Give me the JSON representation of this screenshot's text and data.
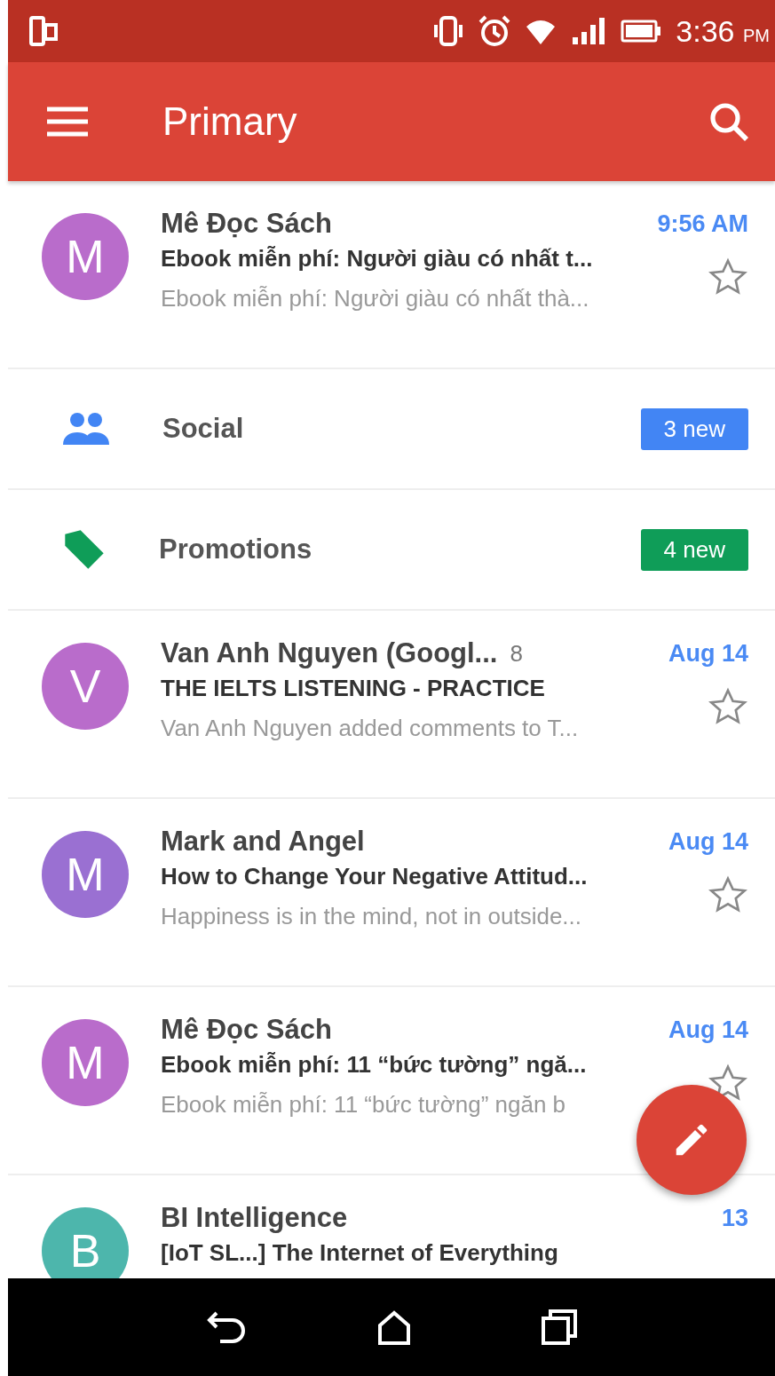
{
  "status_bar": {
    "time": "3:36",
    "ampm": "PM"
  },
  "app_bar": {
    "title": "Primary"
  },
  "items": [
    {
      "kind": "mail",
      "letter": "M",
      "color": "#b96ccb",
      "sender": "Mê Đọc Sách",
      "date": "9:56 AM",
      "subject": "Ebook miễn phí: Người giàu có nhất t...",
      "snippet": "Ebook miễn phí: Người giàu có nhất thà...",
      "starred": false
    },
    {
      "kind": "social",
      "color": "#4285f4",
      "label": "Social",
      "badge": "3 new"
    },
    {
      "kind": "promotions",
      "color": "#0f9d58",
      "label": "Promotions",
      "badge": "4 new"
    },
    {
      "kind": "mail",
      "letter": "V",
      "color": "#b96ccb",
      "sender": "Van Anh Nguyen (Googl...",
      "count": "8",
      "date": "Aug 14",
      "subject": "THE IELTS LISTENING - PRACTICE",
      "snippet": "Van Anh Nguyen added comments to T...",
      "starred": false
    },
    {
      "kind": "mail",
      "letter": "M",
      "color": "#9a70d2",
      "sender": "Mark and Angel",
      "date": "Aug 14",
      "subject": "How to Change Your Negative Attitud...",
      "snippet": "Happiness is in the mind, not in outside...",
      "starred": false
    },
    {
      "kind": "mail",
      "letter": "M",
      "color": "#b96ccb",
      "sender": "Mê Đọc Sách",
      "date": "Aug 14",
      "subject": "Ebook miễn phí: 11 “bức tường” ngă...",
      "snippet": "Ebook miễn phí: 11 “bức tường” ngăn b",
      "starred": false
    },
    {
      "kind": "mail",
      "letter": "B",
      "color": "#4db6ac",
      "sender": "BI Intelligence",
      "date": "13",
      "subject": "[IoT SL...] The Internet of Everything"
    }
  ]
}
